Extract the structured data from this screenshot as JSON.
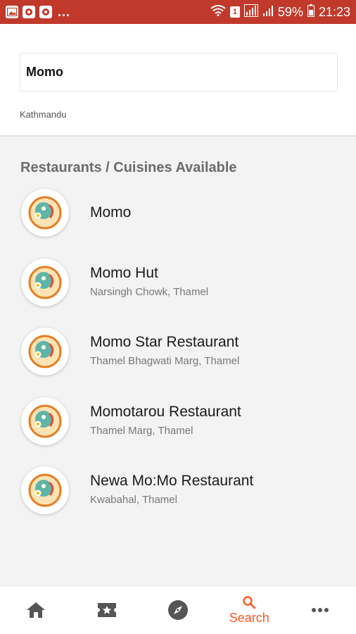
{
  "status_bar": {
    "dots": "...",
    "battery": "59%",
    "time": "21:23",
    "sim_badge": "1",
    "icons": [
      "image-icon",
      "notification-icon",
      "notification-icon",
      "wifi-icon",
      "sim-icon",
      "signal-icon",
      "signal-icon",
      "battery-icon"
    ]
  },
  "search": {
    "query": "Momo",
    "location": "Kathmandu"
  },
  "results": {
    "title": "Restaurants / Cuisines Available",
    "items": [
      {
        "name": "Momo",
        "address": ""
      },
      {
        "name": "Momo Hut",
        "address": "Narsingh Chowk, Thamel"
      },
      {
        "name": "Momo Star Restaurant",
        "address": "Thamel Bhagwati Marg, Thamel"
      },
      {
        "name": "Momotarou Restaurant",
        "address": "Thamel Marg, Thamel"
      },
      {
        "name": "Newa Mo:Mo Restaurant",
        "address": "Kwabahal, Thamel"
      }
    ]
  },
  "bottom_nav": {
    "items": [
      {
        "icon": "home-icon",
        "label": ""
      },
      {
        "icon": "ticket-star-icon",
        "label": ""
      },
      {
        "icon": "compass-icon",
        "label": ""
      },
      {
        "icon": "search-icon",
        "label": "Search"
      },
      {
        "icon": "more-icon",
        "label": ""
      }
    ],
    "active_color": "#ff5722"
  },
  "colors": {
    "status_bar": "#c0392b",
    "accent": "#ff5722"
  }
}
